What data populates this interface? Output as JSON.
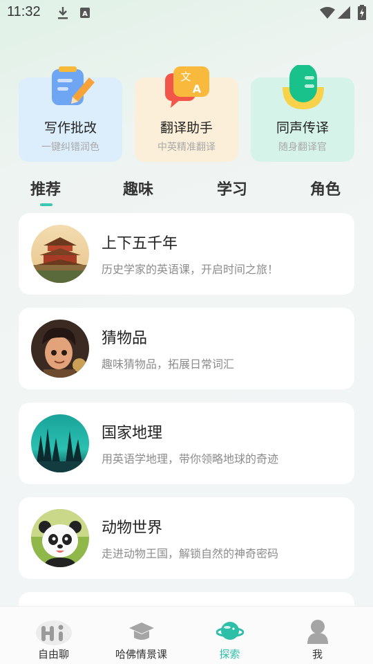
{
  "status_bar": {
    "time": "11:32"
  },
  "features": [
    {
      "title": "写作批改",
      "subtitle": "一键纠错润色",
      "icon": "pencil-notepad-icon",
      "bg": "#dcedfb"
    },
    {
      "title": "翻译助手",
      "subtitle": "中英精准翻译",
      "icon": "translate-icon",
      "bg": "#fcefd9"
    },
    {
      "title": "同声传译",
      "subtitle": "随身翻译官",
      "icon": "microphone-icon",
      "bg": "#d6f3ea"
    }
  ],
  "tabs": [
    {
      "label": "推荐",
      "active": true
    },
    {
      "label": "趣味",
      "active": false
    },
    {
      "label": "学习",
      "active": false
    },
    {
      "label": "角色",
      "active": false
    }
  ],
  "list": [
    {
      "title": "上下五千年",
      "desc": "历史学家的英语课，开启时间之旅！",
      "avatar": "forbidden-city-image"
    },
    {
      "title": "猜物品",
      "desc": "趣味猜物品，拓展日常词汇",
      "avatar": "cartoon-boy-image"
    },
    {
      "title": "国家地理",
      "desc": "用英语学地理，带你领略地球的奇迹",
      "avatar": "aurora-forest-image"
    },
    {
      "title": "动物世界",
      "desc": "走进动物王国，解锁自然的神奇密码",
      "avatar": "panda-image"
    }
  ],
  "bottom_nav": [
    {
      "label": "自由聊",
      "icon": "chat-hi-icon",
      "active": false
    },
    {
      "label": "哈佛情景课",
      "icon": "graduation-cap-icon",
      "active": false
    },
    {
      "label": "探索",
      "icon": "planet-icon",
      "active": true
    },
    {
      "label": "我",
      "icon": "person-icon",
      "active": false
    }
  ],
  "colors": {
    "accent": "#2dbfa8",
    "indicator": "#3cc8b0"
  }
}
